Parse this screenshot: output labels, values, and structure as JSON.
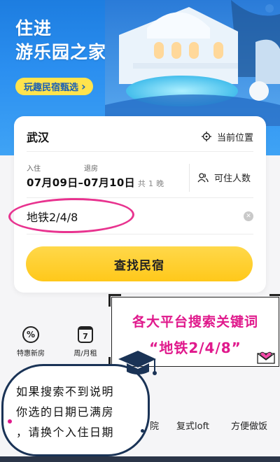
{
  "hero": {
    "title_line1": "住进",
    "title_line2": "游乐园之家",
    "pill_label": "玩趣民宿甄选",
    "pill_chevron": "›"
  },
  "search": {
    "city": "武汉",
    "locate_label": "当前位置",
    "checkin_label": "入住",
    "checkout_label": "退房",
    "dates": "07月09日–07月10日",
    "nights": "共 1 晚",
    "guests_label": "可住人数",
    "keyword": "地铁2/4/8",
    "clear_glyph": "✕",
    "button_label": "查找民宿"
  },
  "quick_entries": [
    {
      "label": "特惠新房",
      "icon": "discount-icon",
      "glyph": "%"
    },
    {
      "label": "周/月租",
      "icon": "calendar-icon",
      "glyph": "7"
    }
  ],
  "tabs_peek": [
    "院",
    "复式loft",
    "方便做饭"
  ],
  "annotation": {
    "title": "各大平台搜索关键词",
    "subtitle": "“地铁2/4/8”"
  },
  "note": {
    "line1": "如果搜索不到说明",
    "line2": "你选的日期已满房",
    "line3": "，请换个入住日期"
  },
  "colors": {
    "hero_blue": "#2b8ff0",
    "pill_yellow": "#ffe34d",
    "button_yellow": "#ffc81a",
    "annotation_pink": "#e0198c",
    "note_border": "#1a3356"
  }
}
